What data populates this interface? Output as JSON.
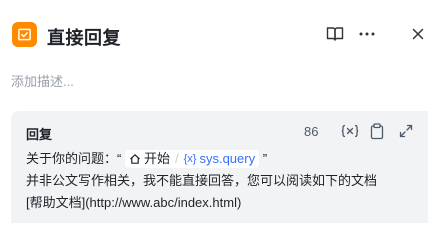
{
  "header": {
    "title": "直接回复",
    "icons": {
      "node": "reply-node-icon",
      "doc": "book-icon",
      "more": "more-icon",
      "close": "close-icon"
    }
  },
  "description": {
    "placeholder": "添加描述..."
  },
  "reply": {
    "label": "回复",
    "char_count": "86",
    "tools": [
      "variable-icon",
      "clipboard-icon",
      "expand-icon"
    ],
    "line1_prefix": "关于你的问题：“",
    "ref_node": "开始",
    "ref_separator": "/",
    "ref_var_prefix": "{x}",
    "ref_var": "sys.query",
    "line1_suffix": "”",
    "line2": "并非公文写作相关，我不能直接回答，您可以阅读如下的文档",
    "line3": "[帮助文档](http://www.abc/index.html)"
  },
  "colors": {
    "accent": "#ff8a00",
    "link": "#3370ff",
    "panel_bg": "#f2f3f5"
  }
}
